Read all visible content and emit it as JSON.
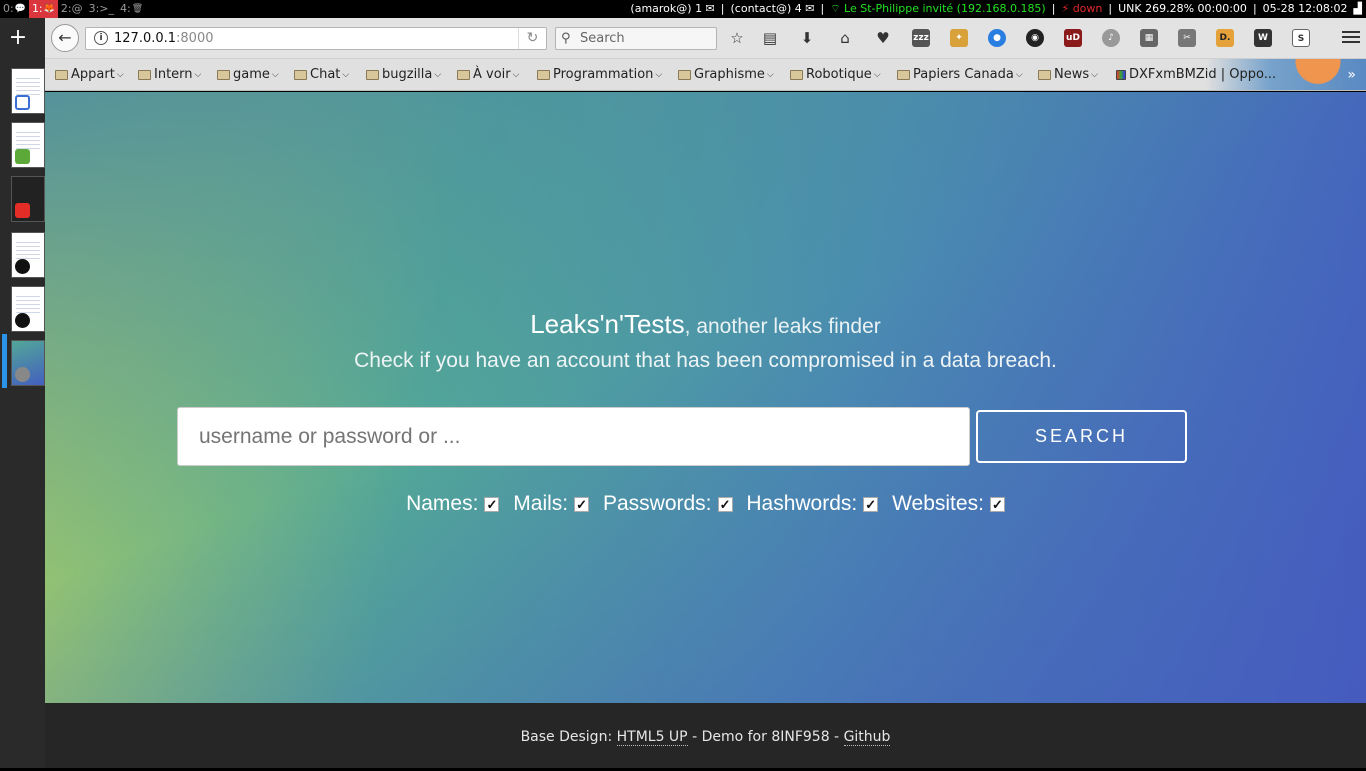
{
  "sysbar": {
    "workspaces": [
      {
        "label": "0:",
        "glyph": "💬"
      },
      {
        "label": "1:",
        "glyph": "🦊",
        "active": true
      },
      {
        "label": "2:@",
        "glyph": ""
      },
      {
        "label": "3:>_",
        "glyph": ""
      },
      {
        "label": "4:",
        "glyph": "🗑"
      }
    ],
    "mail1": "(amarok@) 1 ✉",
    "mail2": "(contact@) 4 ✉",
    "wifi": "Le St-Philippe invité (192.168.0.185)",
    "eth": "down",
    "battery": "UNK 269.28% 00:00:00",
    "clock": "05-28 12:08:02"
  },
  "sidebar": {
    "new_tab": "+"
  },
  "navbar": {
    "url_host": "127.0.0.1",
    "url_port": ":8000",
    "search_placeholder": "Search"
  },
  "bookmarks": [
    "Appart",
    "Intern",
    "game",
    "Chat",
    "bugzilla",
    "À voir",
    "Programmation",
    "Graphisme",
    "Robotique",
    "Papiers Canada",
    "News"
  ],
  "bookmark_page": "DXFxmBMZid | Oppo...",
  "page": {
    "brand": "Leaks'n'Tests",
    "tagline": ", another leaks finder",
    "subtitle": "Check if you have an account that has been compromised in a data breach.",
    "input_placeholder": "username or password or ...",
    "search_label": "SEARCH",
    "filters": [
      {
        "label": "Names:",
        "checked": true
      },
      {
        "label": "Mails:",
        "checked": true
      },
      {
        "label": "Passwords:",
        "checked": true
      },
      {
        "label": "Hashwords:",
        "checked": true
      },
      {
        "label": "Websites:",
        "checked": true
      }
    ]
  },
  "footer": {
    "prefix": "Base Design: ",
    "design_link": "HTML5 UP",
    "middle": " - Demo for 8INF958 - ",
    "github_link": "Github"
  }
}
